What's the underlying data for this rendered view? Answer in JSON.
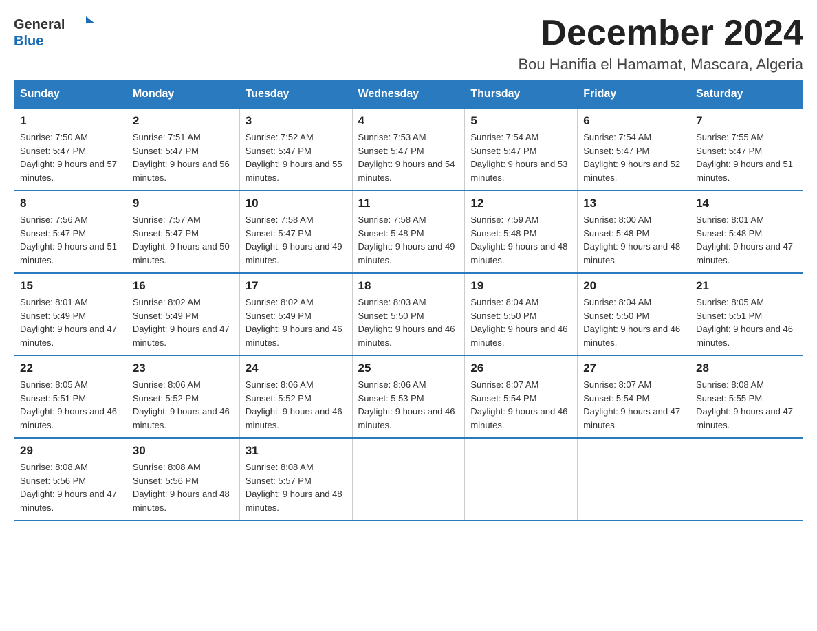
{
  "logo": {
    "general": "General",
    "blue": "Blue"
  },
  "title": "December 2024",
  "location": "Bou Hanifia el Hamamat, Mascara, Algeria",
  "days_of_week": [
    "Sunday",
    "Monday",
    "Tuesday",
    "Wednesday",
    "Thursday",
    "Friday",
    "Saturday"
  ],
  "weeks": [
    [
      {
        "day": "1",
        "sunrise": "7:50 AM",
        "sunset": "5:47 PM",
        "daylight": "9 hours and 57 minutes."
      },
      {
        "day": "2",
        "sunrise": "7:51 AM",
        "sunset": "5:47 PM",
        "daylight": "9 hours and 56 minutes."
      },
      {
        "day": "3",
        "sunrise": "7:52 AM",
        "sunset": "5:47 PM",
        "daylight": "9 hours and 55 minutes."
      },
      {
        "day": "4",
        "sunrise": "7:53 AM",
        "sunset": "5:47 PM",
        "daylight": "9 hours and 54 minutes."
      },
      {
        "day": "5",
        "sunrise": "7:54 AM",
        "sunset": "5:47 PM",
        "daylight": "9 hours and 53 minutes."
      },
      {
        "day": "6",
        "sunrise": "7:54 AM",
        "sunset": "5:47 PM",
        "daylight": "9 hours and 52 minutes."
      },
      {
        "day": "7",
        "sunrise": "7:55 AM",
        "sunset": "5:47 PM",
        "daylight": "9 hours and 51 minutes."
      }
    ],
    [
      {
        "day": "8",
        "sunrise": "7:56 AM",
        "sunset": "5:47 PM",
        "daylight": "9 hours and 51 minutes."
      },
      {
        "day": "9",
        "sunrise": "7:57 AM",
        "sunset": "5:47 PM",
        "daylight": "9 hours and 50 minutes."
      },
      {
        "day": "10",
        "sunrise": "7:58 AM",
        "sunset": "5:47 PM",
        "daylight": "9 hours and 49 minutes."
      },
      {
        "day": "11",
        "sunrise": "7:58 AM",
        "sunset": "5:48 PM",
        "daylight": "9 hours and 49 minutes."
      },
      {
        "day": "12",
        "sunrise": "7:59 AM",
        "sunset": "5:48 PM",
        "daylight": "9 hours and 48 minutes."
      },
      {
        "day": "13",
        "sunrise": "8:00 AM",
        "sunset": "5:48 PM",
        "daylight": "9 hours and 48 minutes."
      },
      {
        "day": "14",
        "sunrise": "8:01 AM",
        "sunset": "5:48 PM",
        "daylight": "9 hours and 47 minutes."
      }
    ],
    [
      {
        "day": "15",
        "sunrise": "8:01 AM",
        "sunset": "5:49 PM",
        "daylight": "9 hours and 47 minutes."
      },
      {
        "day": "16",
        "sunrise": "8:02 AM",
        "sunset": "5:49 PM",
        "daylight": "9 hours and 47 minutes."
      },
      {
        "day": "17",
        "sunrise": "8:02 AM",
        "sunset": "5:49 PM",
        "daylight": "9 hours and 46 minutes."
      },
      {
        "day": "18",
        "sunrise": "8:03 AM",
        "sunset": "5:50 PM",
        "daylight": "9 hours and 46 minutes."
      },
      {
        "day": "19",
        "sunrise": "8:04 AM",
        "sunset": "5:50 PM",
        "daylight": "9 hours and 46 minutes."
      },
      {
        "day": "20",
        "sunrise": "8:04 AM",
        "sunset": "5:50 PM",
        "daylight": "9 hours and 46 minutes."
      },
      {
        "day": "21",
        "sunrise": "8:05 AM",
        "sunset": "5:51 PM",
        "daylight": "9 hours and 46 minutes."
      }
    ],
    [
      {
        "day": "22",
        "sunrise": "8:05 AM",
        "sunset": "5:51 PM",
        "daylight": "9 hours and 46 minutes."
      },
      {
        "day": "23",
        "sunrise": "8:06 AM",
        "sunset": "5:52 PM",
        "daylight": "9 hours and 46 minutes."
      },
      {
        "day": "24",
        "sunrise": "8:06 AM",
        "sunset": "5:52 PM",
        "daylight": "9 hours and 46 minutes."
      },
      {
        "day": "25",
        "sunrise": "8:06 AM",
        "sunset": "5:53 PM",
        "daylight": "9 hours and 46 minutes."
      },
      {
        "day": "26",
        "sunrise": "8:07 AM",
        "sunset": "5:54 PM",
        "daylight": "9 hours and 46 minutes."
      },
      {
        "day": "27",
        "sunrise": "8:07 AM",
        "sunset": "5:54 PM",
        "daylight": "9 hours and 47 minutes."
      },
      {
        "day": "28",
        "sunrise": "8:08 AM",
        "sunset": "5:55 PM",
        "daylight": "9 hours and 47 minutes."
      }
    ],
    [
      {
        "day": "29",
        "sunrise": "8:08 AM",
        "sunset": "5:56 PM",
        "daylight": "9 hours and 47 minutes."
      },
      {
        "day": "30",
        "sunrise": "8:08 AM",
        "sunset": "5:56 PM",
        "daylight": "9 hours and 48 minutes."
      },
      {
        "day": "31",
        "sunrise": "8:08 AM",
        "sunset": "5:57 PM",
        "daylight": "9 hours and 48 minutes."
      },
      null,
      null,
      null,
      null
    ]
  ]
}
